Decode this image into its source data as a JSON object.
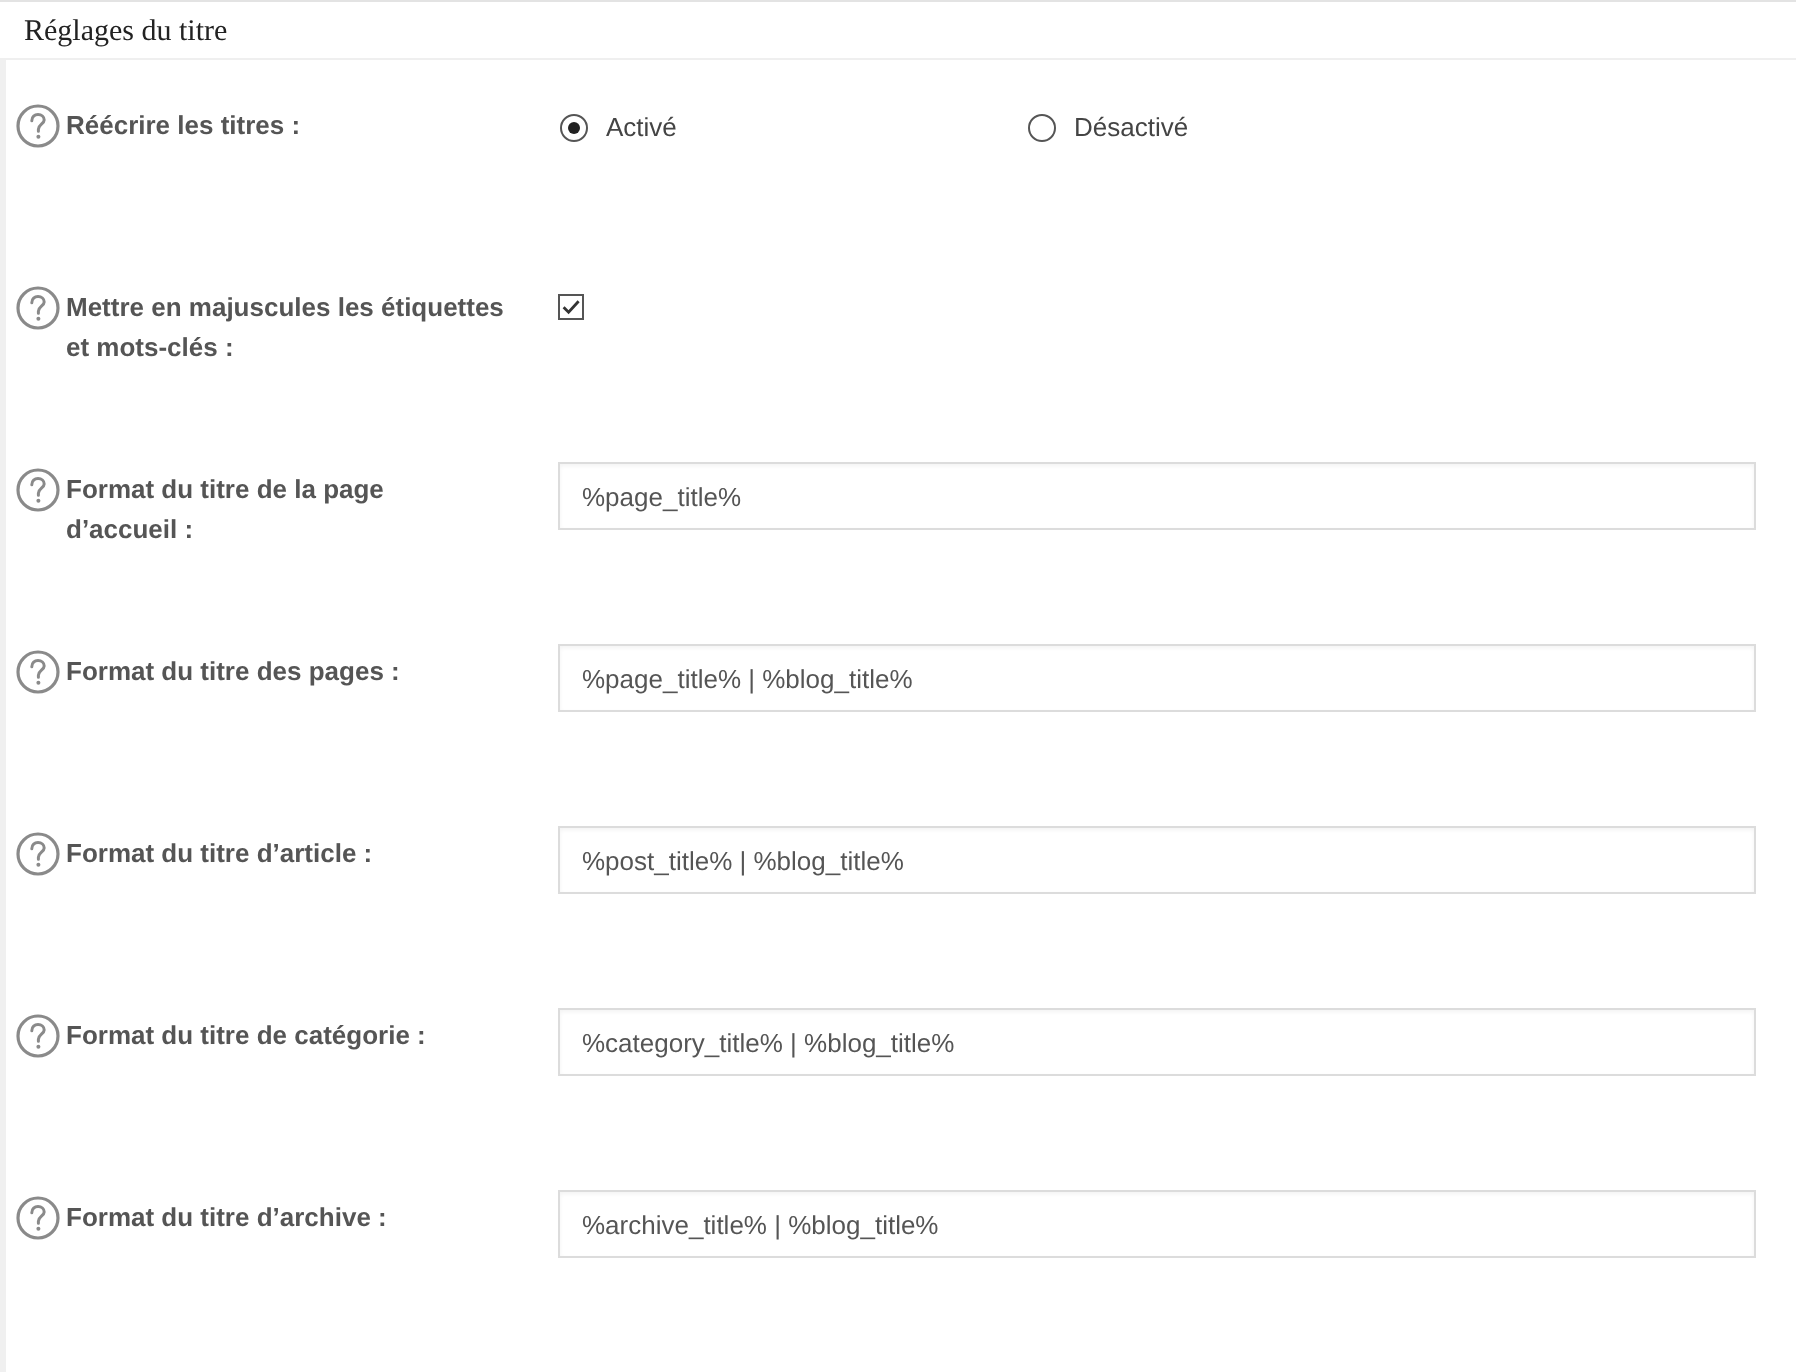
{
  "section": {
    "title": "Réglages du titre"
  },
  "settings": [
    {
      "kind": "radio",
      "label": "Réécrire les titres :",
      "options": [
        {
          "label": "Activé",
          "selected": true
        },
        {
          "label": "Désactivé",
          "selected": false
        }
      ]
    },
    {
      "kind": "checkbox",
      "label": "Mettre en majuscules les étiquettes et mots-clés :",
      "checked": true
    },
    {
      "kind": "text",
      "label": "Format du titre de la page d’accueil :",
      "value": "%page_title%"
    },
    {
      "kind": "text",
      "label": "Format du titre des pages :",
      "value": "%page_title% | %blog_title%"
    },
    {
      "kind": "text",
      "label": "Format du titre d’article :",
      "value": "%post_title% | %blog_title%"
    },
    {
      "kind": "text",
      "label": "Format du titre de catégorie :",
      "value": "%category_title% | %blog_title%"
    },
    {
      "kind": "text",
      "label": "Format du titre d’archive :",
      "value": "%archive_title% | %blog_title%"
    }
  ]
}
